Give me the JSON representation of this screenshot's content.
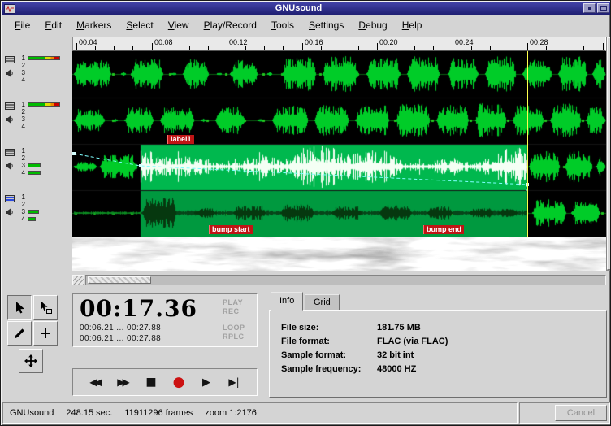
{
  "window": {
    "title": "GNUsound"
  },
  "menu": {
    "items": [
      "File",
      "Edit",
      "Markers",
      "Select",
      "View",
      "Play/Record",
      "Tools",
      "Settings",
      "Debug",
      "Help"
    ]
  },
  "ruler": {
    "labels": [
      "00:04",
      "00:08",
      "00:12",
      "00:16",
      "00:20",
      "00:24",
      "00:28"
    ]
  },
  "track_panel": {
    "channel_labels": [
      "1",
      "2",
      "3",
      "4"
    ],
    "tracks": [
      {
        "name": "track-1",
        "meter": "gradient-full"
      },
      {
        "name": "track-2",
        "meter": "gradient-full"
      },
      {
        "name": "track-3",
        "meter": "green-short"
      },
      {
        "name": "track-4",
        "meter": "green-short"
      }
    ]
  },
  "markers": [
    {
      "label": "label1"
    },
    {
      "label": "bump start"
    },
    {
      "label": "bump end"
    }
  ],
  "time_display": {
    "main_time": "00:17.36",
    "selection_range": "00:06.21 ... 00:27.88",
    "loop_range": "00:06.21 ... 00:27.88",
    "indicators": [
      "PLAY",
      "REC",
      "LOOP",
      "RPLC"
    ]
  },
  "transport": {
    "buttons": [
      {
        "name": "seek-start",
        "glyph": "◀◀"
      },
      {
        "name": "seek-end",
        "glyph": "▶▶"
      },
      {
        "name": "stop",
        "glyph": "■"
      },
      {
        "name": "record",
        "glyph": "●"
      },
      {
        "name": "play",
        "glyph": "▶"
      },
      {
        "name": "play-to-end",
        "glyph": "▶|"
      }
    ]
  },
  "info_panel": {
    "tabs": [
      "Info",
      "Grid"
    ],
    "active_tab": "Info",
    "rows": [
      {
        "label": "File size:",
        "value": "181.75 MB"
      },
      {
        "label": "File format:",
        "value": "FLAC (via FLAC)"
      },
      {
        "label": "Sample format:",
        "value": "32 bit int"
      },
      {
        "label": "Sample frequency:",
        "value": "48000 HZ"
      }
    ]
  },
  "status_bar": {
    "app": "GNUsound",
    "duration": "248.15 sec.",
    "frames": "11911296 frames",
    "zoom": "zoom 1:2176",
    "cancel_label": "Cancel"
  },
  "colors": {
    "titlebar_blue": "#2a2a8e",
    "waveform_green": "#00cc28",
    "selection_track3": "#00b84e",
    "selection_track4": "#00993f",
    "selection_line_yellow": "#ffff4d",
    "envelope_cyan": "#7dffff",
    "marker_red": "#bf1515"
  }
}
